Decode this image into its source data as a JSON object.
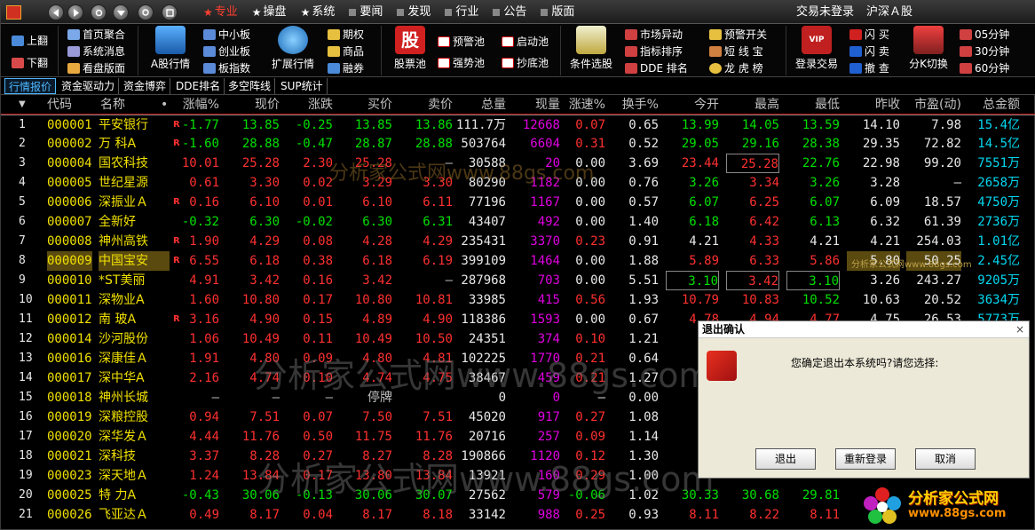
{
  "titlebar": {
    "menu": [
      {
        "label": "专业",
        "icon": "star",
        "active": true
      },
      {
        "label": "操盘",
        "icon": "star"
      },
      {
        "label": "系统",
        "icon": "star"
      },
      {
        "label": "要闻",
        "icon": "square"
      },
      {
        "label": "发现",
        "icon": "square"
      },
      {
        "label": "行业",
        "icon": "square"
      },
      {
        "label": "公告",
        "icon": "square"
      },
      {
        "label": "版面",
        "icon": "square"
      }
    ],
    "login_status": "交易未登录",
    "market": "沪深Ａ股"
  },
  "toolbar": {
    "page_up": "上翻",
    "page_down": "下翻",
    "home": "首页聚合",
    "sys_msg": "系统消息",
    "view_board": "看盘版面",
    "a_stock_quote": "A股行情",
    "sme": "中小板",
    "gem": "创业板",
    "board_index": "板指数",
    "ext_quote": "扩展行情",
    "options": "期权",
    "commodity": "商品",
    "margin": "融券",
    "stock_pool": "股票池",
    "stock_pool_icon": "股",
    "warn_pool": "预警池",
    "strong_pool": "强势池",
    "start_pool": "启动池",
    "bottom_pool": "抄底池",
    "cond_select": "条件选股",
    "market_anomaly": "市场异动",
    "index_sort": "指标排序",
    "dde_rank": "DDE 排名",
    "warn_switch": "预警开关",
    "short_trade": "短 线 宝",
    "dragon_tiger": "龙 虎 榜",
    "login_trade": "登录交易",
    "vip": "VIP",
    "flash_buy": "闪 买",
    "flash_sell": "闪 卖",
    "cancel": "撤 查",
    "period_switch": "分K切换",
    "min05": "05分钟",
    "min30": "30分钟",
    "min60": "60分钟"
  },
  "tabs": [
    "行情报价",
    "资金驱动力",
    "资金博弈",
    "DDE排名",
    "多空阵线",
    "SUP统计"
  ],
  "table": {
    "headers": [
      "代码",
      "名称",
      "•",
      "涨幅%",
      "现价",
      "涨跌",
      "买价",
      "卖价",
      "总量",
      "现量",
      "涨速%",
      "换手%",
      "今开",
      "最高",
      "最低",
      "昨收",
      "市盈(动)",
      "总金额"
    ],
    "rows": [
      {
        "idx": "1",
        "code": "000001",
        "name": "平安银行",
        "r": "R",
        "chg_pct": "-1.77",
        "price": "13.85",
        "chg": "-0.25",
        "bid": "13.85",
        "ask": "13.86",
        "vol": "111.7万",
        "cur": "12668",
        "speed": "0.07",
        "turnover": "0.65",
        "open": "13.99",
        "high": "14.05",
        "low": "13.59",
        "prev": "14.10",
        "pe": "7.98",
        "amount": "15.4亿"
      },
      {
        "idx": "2",
        "code": "000002",
        "name": "万 科A",
        "r": "R",
        "chg_pct": "-1.60",
        "price": "28.88",
        "chg": "-0.47",
        "bid": "28.87",
        "ask": "28.88",
        "vol": "503764",
        "cur": "6604",
        "speed": "0.31",
        "turnover": "0.52",
        "open": "29.05",
        "high": "29.16",
        "low": "28.38",
        "prev": "29.35",
        "pe": "72.82",
        "amount": "14.5亿"
      },
      {
        "idx": "3",
        "code": "000004",
        "name": "国农科技",
        "r": "",
        "chg_pct": "10.01",
        "price": "25.28",
        "chg": "2.30",
        "bid": "25.28",
        "ask": "—",
        "vol": "30588",
        "cur": "20",
        "speed": "0.00",
        "turnover": "3.69",
        "open": "23.44",
        "high": "25.28",
        "low": "22.76",
        "prev": "22.98",
        "pe": "99.20",
        "amount": "7551万"
      },
      {
        "idx": "4",
        "code": "000005",
        "name": "世纪星源",
        "r": "",
        "chg_pct": "0.61",
        "price": "3.30",
        "chg": "0.02",
        "bid": "3.29",
        "ask": "3.30",
        "vol": "80290",
        "cur": "1182",
        "speed": "0.00",
        "turnover": "0.76",
        "open": "3.26",
        "high": "3.34",
        "low": "3.26",
        "prev": "3.28",
        "pe": "—",
        "amount": "2658万"
      },
      {
        "idx": "5",
        "code": "000006",
        "name": "深振业Ａ",
        "r": "R",
        "chg_pct": "0.16",
        "price": "6.10",
        "chg": "0.01",
        "bid": "6.10",
        "ask": "6.11",
        "vol": "77196",
        "cur": "1167",
        "speed": "0.00",
        "turnover": "0.57",
        "open": "6.07",
        "high": "6.25",
        "low": "6.07",
        "prev": "6.09",
        "pe": "18.57",
        "amount": "4750万"
      },
      {
        "idx": "6",
        "code": "000007",
        "name": "全新好",
        "r": "",
        "chg_pct": "-0.32",
        "price": "6.30",
        "chg": "-0.02",
        "bid": "6.30",
        "ask": "6.31",
        "vol": "43407",
        "cur": "492",
        "speed": "0.00",
        "turnover": "1.40",
        "open": "6.18",
        "high": "6.42",
        "low": "6.13",
        "prev": "6.32",
        "pe": "61.39",
        "amount": "2736万"
      },
      {
        "idx": "7",
        "code": "000008",
        "name": "神州高铁",
        "r": "R",
        "chg_pct": "1.90",
        "price": "4.29",
        "chg": "0.08",
        "bid": "4.28",
        "ask": "4.29",
        "vol": "235431",
        "cur": "3370",
        "speed": "0.23",
        "turnover": "0.91",
        "open": "4.21",
        "high": "4.33",
        "low": "4.21",
        "prev": "4.21",
        "pe": "254.03",
        "amount": "1.01亿"
      },
      {
        "idx": "8",
        "code": "000009",
        "name": "中国宝安",
        "r": "R",
        "chg_pct": "6.55",
        "price": "6.18",
        "chg": "0.38",
        "bid": "6.18",
        "ask": "6.19",
        "vol": "399109",
        "cur": "1464",
        "speed": "0.00",
        "turnover": "1.88",
        "open": "5.89",
        "high": "6.33",
        "low": "5.86",
        "prev": "5.80",
        "pe": "50.25",
        "amount": "2.45亿"
      },
      {
        "idx": "9",
        "code": "000010",
        "name": "*ST美丽",
        "r": "",
        "chg_pct": "4.91",
        "price": "3.42",
        "chg": "0.16",
        "bid": "3.42",
        "ask": "—",
        "vol": "287968",
        "cur": "703",
        "speed": "0.00",
        "turnover": "5.51",
        "open": "3.10",
        "high": "3.42",
        "low": "3.10",
        "prev": "3.26",
        "pe": "243.27",
        "amount": "9205万"
      },
      {
        "idx": "10",
        "code": "000011",
        "name": "深物业A",
        "r": "",
        "chg_pct": "1.60",
        "price": "10.80",
        "chg": "0.17",
        "bid": "10.80",
        "ask": "10.81",
        "vol": "33985",
        "cur": "415",
        "speed": "0.56",
        "turnover": "1.93",
        "open": "10.79",
        "high": "10.83",
        "low": "10.52",
        "prev": "10.63",
        "pe": "20.52",
        "amount": "3634万"
      },
      {
        "idx": "11",
        "code": "000012",
        "name": "南 玻A",
        "r": "R",
        "chg_pct": "3.16",
        "price": "4.90",
        "chg": "0.15",
        "bid": "4.89",
        "ask": "4.90",
        "vol": "118386",
        "cur": "1593",
        "speed": "0.00",
        "turnover": "0.67",
        "open": "4.78",
        "high": "4.94",
        "low": "4.77",
        "prev": "4.75",
        "pe": "26.53",
        "amount": "5773万"
      },
      {
        "idx": "12",
        "code": "000014",
        "name": "沙河股份",
        "r": "",
        "chg_pct": "1.06",
        "price": "10.49",
        "chg": "0.11",
        "bid": "10.49",
        "ask": "10.50",
        "vol": "24351",
        "cur": "374",
        "speed": "0.10",
        "turnover": "1.21",
        "open": "",
        "high": "",
        "low": "",
        "prev": "",
        "pe": "",
        "amount": ""
      },
      {
        "idx": "13",
        "code": "000016",
        "name": "深康佳Ａ",
        "r": "",
        "chg_pct": "1.91",
        "price": "4.80",
        "chg": "0.09",
        "bid": "4.80",
        "ask": "4.81",
        "vol": "102225",
        "cur": "1770",
        "speed": "0.21",
        "turnover": "0.64",
        "open": "",
        "high": "",
        "low": "",
        "prev": "",
        "pe": "",
        "amount": ""
      },
      {
        "idx": "14",
        "code": "000017",
        "name": "深中华A",
        "r": "",
        "chg_pct": "2.16",
        "price": "4.74",
        "chg": "0.10",
        "bid": "4.74",
        "ask": "4.75",
        "vol": "38467",
        "cur": "459",
        "speed": "0.21",
        "turnover": "1.27",
        "open": "",
        "high": "",
        "low": "",
        "prev": "",
        "pe": "",
        "amount": ""
      },
      {
        "idx": "15",
        "code": "000018",
        "name": "神州长城",
        "r": "",
        "chg_pct": "—",
        "price": "—",
        "chg": "—",
        "bid": "停牌",
        "ask": "",
        "vol": "0",
        "cur": "0",
        "speed": "—",
        "turnover": "0.00",
        "open": "",
        "high": "",
        "low": "",
        "prev": "",
        "pe": "",
        "amount": ""
      },
      {
        "idx": "16",
        "code": "000019",
        "name": "深粮控股",
        "r": "",
        "chg_pct": "0.94",
        "price": "7.51",
        "chg": "0.07",
        "bid": "7.50",
        "ask": "7.51",
        "vol": "45020",
        "cur": "917",
        "speed": "0.27",
        "turnover": "1.08",
        "open": "",
        "high": "",
        "low": "",
        "prev": "",
        "pe": "",
        "amount": ""
      },
      {
        "idx": "17",
        "code": "000020",
        "name": "深华发Ａ",
        "r": "",
        "chg_pct": "4.44",
        "price": "11.76",
        "chg": "0.50",
        "bid": "11.75",
        "ask": "11.76",
        "vol": "20716",
        "cur": "257",
        "speed": "0.09",
        "turnover": "1.14",
        "open": "",
        "high": "",
        "low": "",
        "prev": "",
        "pe": "",
        "amount": ""
      },
      {
        "idx": "18",
        "code": "000021",
        "name": "深科技",
        "r": "",
        "chg_pct": "3.37",
        "price": "8.28",
        "chg": "0.27",
        "bid": "8.27",
        "ask": "8.28",
        "vol": "190866",
        "cur": "1120",
        "speed": "0.12",
        "turnover": "1.30",
        "open": "",
        "high": "",
        "low": "",
        "prev": "",
        "pe": "",
        "amount": ""
      },
      {
        "idx": "19",
        "code": "000023",
        "name": "深天地Ａ",
        "r": "",
        "chg_pct": "1.24",
        "price": "13.84",
        "chg": "0.17",
        "bid": "13.80",
        "ask": "13.84",
        "vol": "13921",
        "cur": "160",
        "speed": "0.29",
        "turnover": "1.00",
        "open": "",
        "high": "",
        "low": "",
        "prev": "",
        "pe": "",
        "amount": ""
      },
      {
        "idx": "20",
        "code": "000025",
        "name": "特 力A",
        "r": "",
        "chg_pct": "-0.43",
        "price": "30.06",
        "chg": "-0.13",
        "bid": "30.06",
        "ask": "30.07",
        "vol": "27562",
        "cur": "579",
        "speed": "-0.06",
        "turnover": "1.02",
        "open": "30.33",
        "high": "30.68",
        "low": "29.81",
        "prev": "",
        "pe": "",
        "amount": ""
      },
      {
        "idx": "21",
        "code": "000026",
        "name": "飞亚达Ａ",
        "r": "",
        "chg_pct": "0.49",
        "price": "8.17",
        "chg": "0.04",
        "bid": "8.17",
        "ask": "8.18",
        "vol": "33142",
        "cur": "988",
        "speed": "0.25",
        "turnover": "0.93",
        "open": "8.11",
        "high": "8.22",
        "low": "8.11",
        "prev": "",
        "pe": "",
        "amount": ""
      }
    ]
  },
  "watermark": {
    "small": "分析家公式网www.88gs.com",
    "big1": "分析家公式网www.88gs.com",
    "big2": "分析家公式网www.88gs.com",
    "tiny": "分析家公式网www.88gs.com"
  },
  "dialog": {
    "title": "退出确认",
    "message": "您确定退出本系统吗?请您选择:",
    "btn_exit": "退出",
    "btn_relogin": "重新登录",
    "btn_cancel": "取消",
    "close": "×"
  },
  "brand": {
    "text": "分析家公式网",
    "url": "www.88gs.com"
  },
  "colors": {
    "up": "#ff3030",
    "down": "#00e000",
    "code": "#f0e000",
    "volume": "#e000e0",
    "amount": "#00d8f0"
  }
}
